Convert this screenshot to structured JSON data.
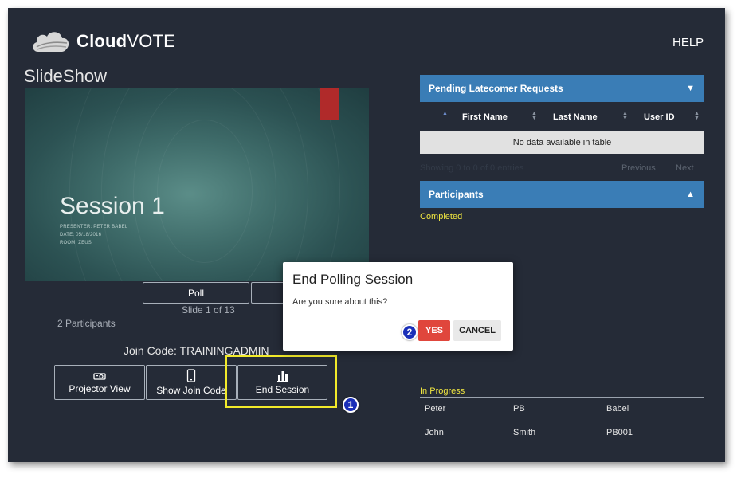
{
  "header": {
    "logo_bold": "Cloud",
    "logo_light": "VOTE",
    "help_label": "HELP"
  },
  "slideshow": {
    "title": "SlideShow",
    "slide": {
      "title": "Session 1",
      "presenter": "PRESENTER: PETER BABEL",
      "date": "DATE: 05/18/2016",
      "room": "ROOM: ZEUS"
    },
    "poll_label": "Poll",
    "slide_counter": "Slide 1 of 13",
    "participants_count": "2 Participants",
    "join_code": "Join Code: TRAININGADMIN",
    "actions": [
      {
        "label": "Projector View",
        "icon": "projector-icon"
      },
      {
        "label": "Show Join Code",
        "icon": "phone-icon"
      },
      {
        "label": "End Session",
        "icon": "bar-chart-icon"
      }
    ]
  },
  "latecomers": {
    "title": "Pending Latecomer Requests",
    "columns": [
      "First Name",
      "Last Name",
      "User ID"
    ],
    "empty_message": "No data available in table",
    "entries_info": "Showing 0 to 0 of 0 entries",
    "previous_label": "Previous",
    "next_label": "Next"
  },
  "participants": {
    "title": "Participants",
    "completed_label": "Completed",
    "in_progress_label": "In Progress",
    "rows": [
      [
        "Peter",
        "PB",
        "Babel"
      ],
      [
        "John",
        "Smith",
        "PB001"
      ]
    ]
  },
  "dialog": {
    "title": "End Polling Session",
    "message": "Are you sure about this?",
    "yes_label": "YES",
    "cancel_label": "CANCEL"
  },
  "annotations": {
    "step1": "1",
    "step2": "2"
  },
  "colors": {
    "background": "#252b37",
    "panel_header": "#3a7db6",
    "highlight": "#f2ea2a",
    "yes_button": "#e0463c",
    "status_label": "#f0e640",
    "badge": "#1a2fb8"
  }
}
